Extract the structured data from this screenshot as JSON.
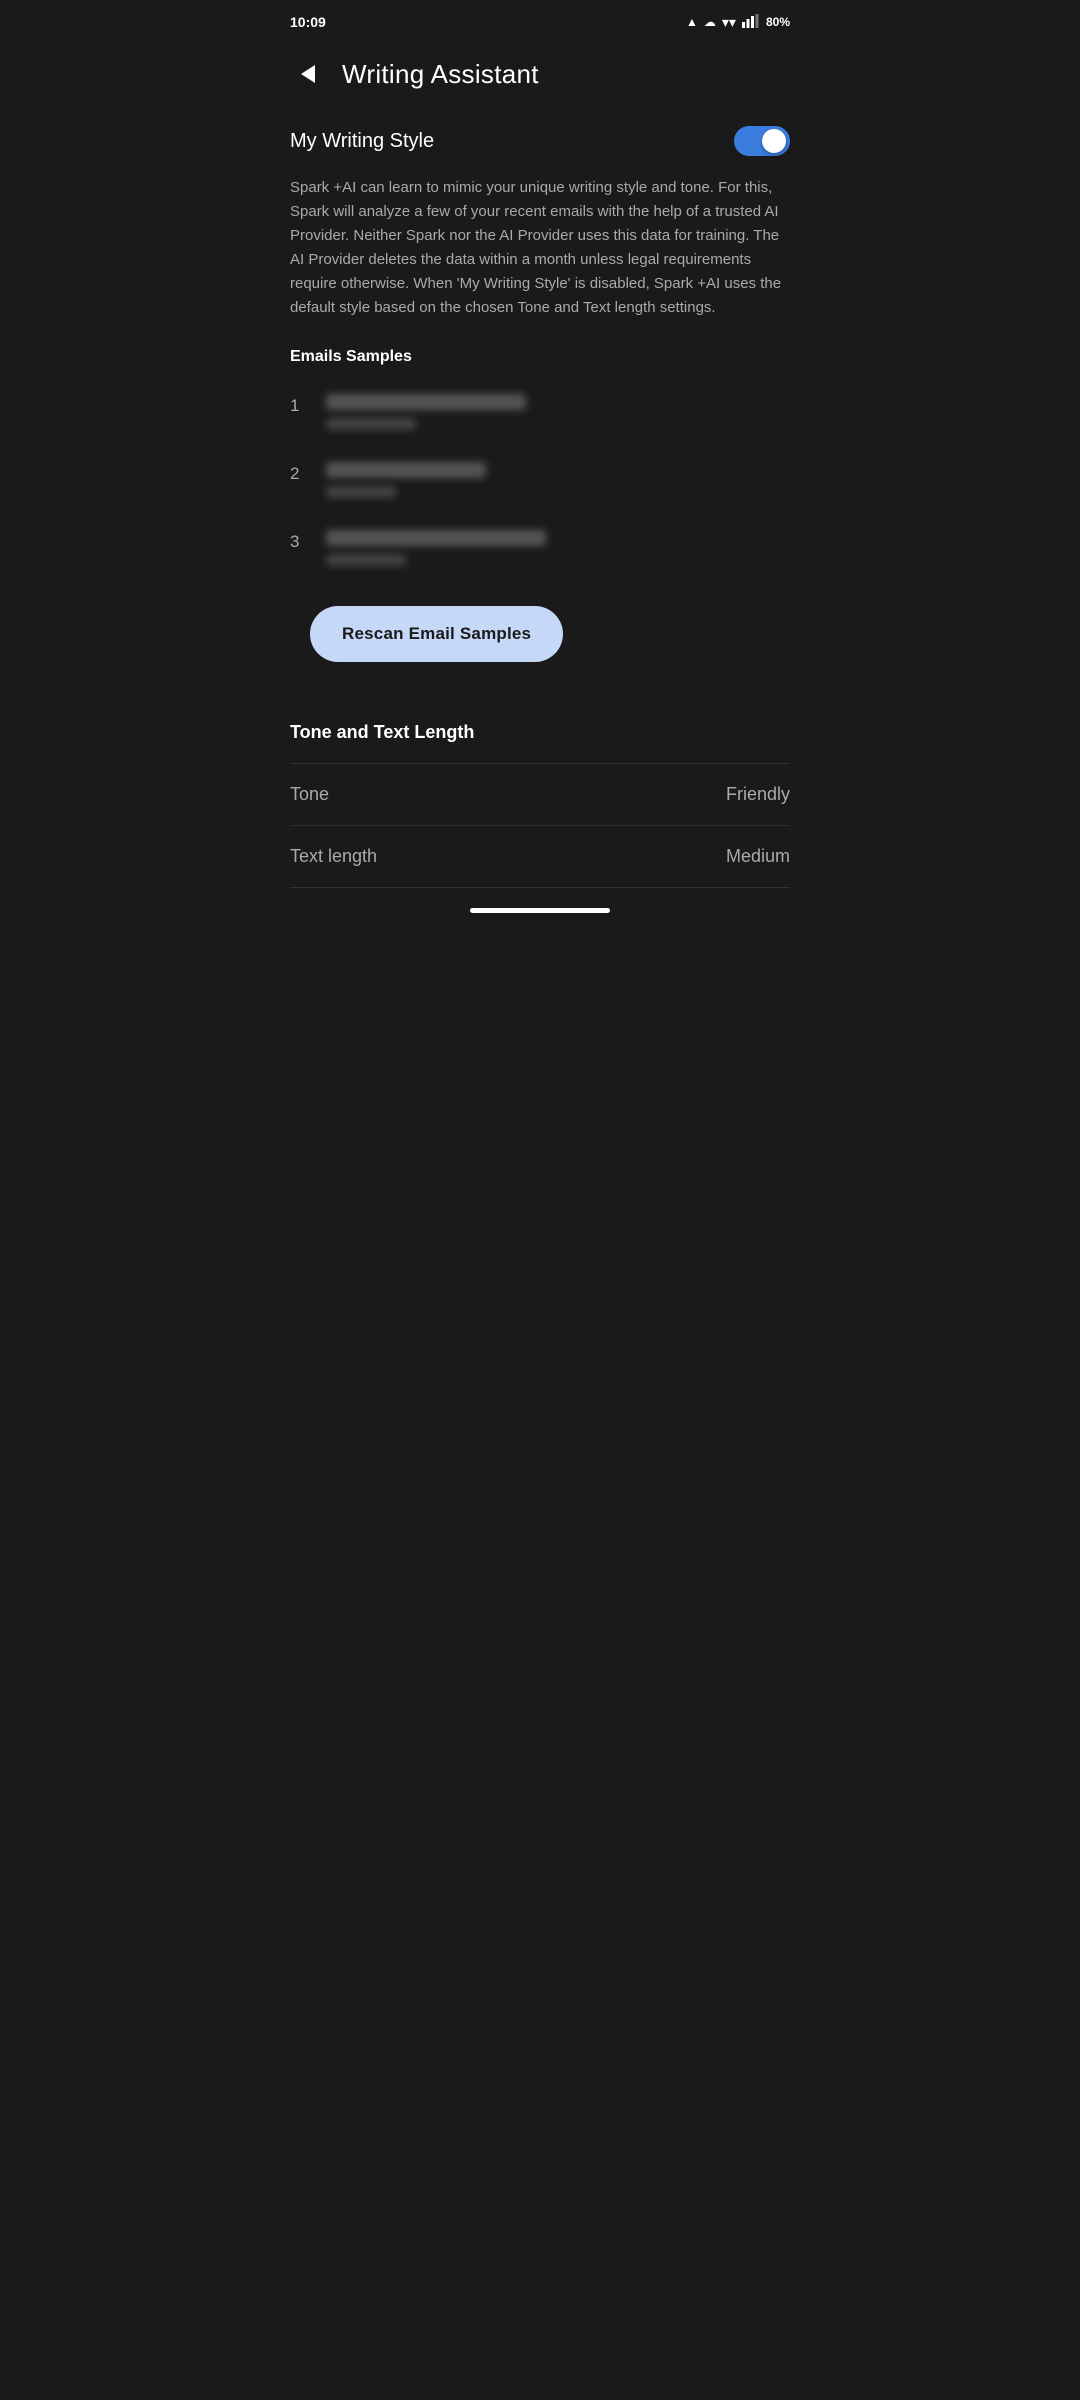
{
  "statusBar": {
    "time": "10:09",
    "battery": "80%",
    "batteryIcon": "battery-icon",
    "wifiIcon": "wifi-icon",
    "signalIcon": "signal-icon",
    "notificationIcon": "notification-icon",
    "cloudIcon": "cloud-icon"
  },
  "header": {
    "backButton": "back-button",
    "title": "Writing Assistant"
  },
  "myWritingStyle": {
    "label": "My Writing Style",
    "toggleEnabled": true
  },
  "description": {
    "text": "Spark +AI can learn to mimic your unique writing style and tone. For this, Spark will analyze a few of your recent emails with the help of a trusted AI Provider. Neither Spark nor the AI Provider uses this data for training. The AI Provider deletes the data within a month unless legal requirements require otherwise. When 'My Writing Style' is disabled, Spark +AI uses the default style based on the chosen Tone and Text length settings."
  },
  "emailSamples": {
    "sectionTitle": "Emails Samples",
    "items": [
      {
        "number": "1",
        "subjectBlurred": true,
        "previewBlurred": true
      },
      {
        "number": "2",
        "subjectBlurred": true,
        "previewBlurred": true
      },
      {
        "number": "3",
        "subjectBlurred": true,
        "previewBlurred": true
      }
    ]
  },
  "rescanButton": {
    "label": "Rescan Email Samples"
  },
  "toneAndTextLength": {
    "sectionTitle": "Tone and Text Length",
    "tone": {
      "label": "Tone",
      "value": "Friendly"
    },
    "textLength": {
      "label": "Text length",
      "value": "Medium"
    }
  },
  "homeIndicator": {
    "visible": true
  }
}
